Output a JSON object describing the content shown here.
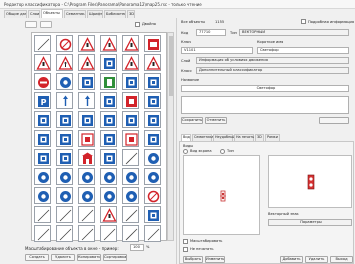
{
  "window": {
    "title": "Редактор классификатора - C:\\Program Files\\Panorama\\Panorama12\\map25.rsc - только чтение"
  },
  "tabs": [
    "Общие данные",
    "Слои",
    "Объекты",
    "Семантика",
    "Шрифты",
    "Библиотеки",
    "3D"
  ],
  "left": {
    "toolbar_checkbox_label": "Двойно",
    "bottom_text": "Масштабирование объекта в окне - пример:",
    "scale_value": "100",
    "scale_unit": "%",
    "buttons": [
      "Создать",
      "Удалить",
      "Копировать",
      "Сортировка"
    ]
  },
  "right": {
    "header_label": "Все объекты",
    "header_count": "1155",
    "header_checkbox_label": "Подробная информация",
    "kod_label": "Код",
    "kod_value": "77710",
    "type_label": "Тип",
    "type_value": "ВЕКТОРНЫЙ",
    "key_label": "Ключ",
    "name_label": "Короткое имя",
    "key_value": "V1101",
    "name_value": "Светофор",
    "layer_label": "Слой",
    "layer_value": "Информация об условиях движения",
    "class_label": "Класс",
    "class_value": "Дополнительный классификатор",
    "full_name_label": "Название",
    "full_name_value": "Светофор",
    "link_buttons": [
      "Сохранить",
      "Отменить"
    ],
    "subtabs": [
      "Вид",
      "Семантика",
      "Неудобный",
      "На печать",
      "3D",
      "Рамки"
    ],
    "extra_label": "Виды",
    "radio1": "Вид экрана",
    "radio2": "Тип",
    "bottom_field_label": "Векторный знак",
    "bottom_field_value": "Параметры",
    "check1": "Масштабировать",
    "check2": "Не печатать",
    "preview_buttons": [
      "Выбрать",
      "Изменить"
    ],
    "footer_buttons": [
      "Добавить",
      "Удалить",
      "Выход"
    ]
  },
  "icons": [
    [
      "line-diagonal-icon",
      "no-entry-icon",
      "warning-triangle-icon",
      "warning-triangle-icon",
      "warning-triangle-icon",
      "traffic-sign-icon"
    ],
    [
      "warning-triangle-icon",
      "pedestrian-sign-icon",
      "warning-triangle-icon",
      "blue-square-icon",
      "warning-triangle-icon",
      "warning-triangle-icon"
    ],
    [
      "red-circle-icon",
      "blue-circle-icon",
      "blue-square-icon",
      "green-square-icon",
      "blue-square-icon",
      "blue-square-icon"
    ],
    [
      "parking-sign-icon",
      "arrow-icon",
      "arrow-icon",
      "blue-square-icon",
      "red-square-icon",
      "blue-square-icon"
    ],
    [
      "blue-square-icon",
      "blue-square-icon",
      "blue-square-icon",
      "blue-square-icon",
      "blue-square-icon",
      "blue-square-icon"
    ],
    [
      "blue-square-icon",
      "blue-square-icon",
      "red-sign-icon",
      "blue-square-icon",
      "red-sign-icon",
      "blue-square-icon"
    ],
    [
      "blue-square-icon",
      "blue-square-icon",
      "building-icon",
      "blue-square-icon",
      "line-diagonal-icon",
      "blue-circle-icon"
    ],
    [
      "blue-circle-icon",
      "blue-circle-icon",
      "blue-circle-icon",
      "blue-circle-icon",
      "blue-circle-icon",
      "blue-circle-icon"
    ],
    [
      "blue-circle-icon",
      "blue-circle-icon",
      "blue-circle-icon",
      "blue-circle-icon",
      "blue-circle-icon",
      "no-entry-icon"
    ],
    [
      "line-diagonal-icon",
      "line-diagonal-icon",
      "line-diagonal-icon",
      "warning-triangle-icon",
      "line-diagonal-icon",
      "blue-square-icon"
    ],
    [
      "line-diagonal-icon",
      "line-diagonal-icon",
      "line-diagonal-icon",
      "line-diagonal-icon",
      "line-diagonal-icon",
      "line-diagonal-icon"
    ]
  ],
  "colors": {
    "accent_blue": "#1f5fb3",
    "sign_red": "#d2232a",
    "traffic_light_red": "#c83030"
  }
}
